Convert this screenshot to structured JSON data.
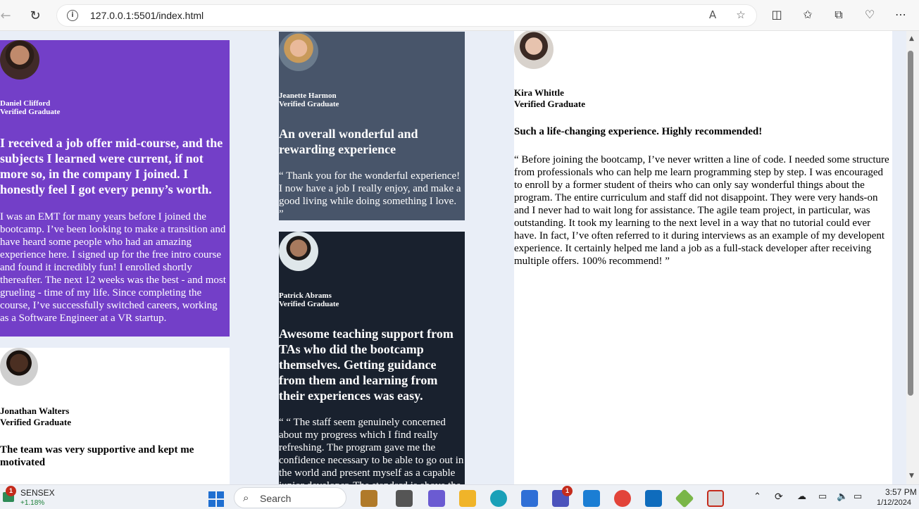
{
  "browser": {
    "url": "127.0.0.1:5501/index.html"
  },
  "testimonials": [
    {
      "name": "Daniel Clifford",
      "role": "Verified Graduate",
      "headline": "I received a job offer mid-course, and the subjects I learned were current, if not more so, in the company I joined. I honestly feel I got every penny’s worth.",
      "quote": "I was an EMT for many years before I joined the bootcamp. I’ve been looking to make a transition and have heard some people who had an amazing experience here. I signed up for the free intro course and found it incredibly fun! I enrolled shortly thereafter. The next 12 weeks was the best - and most grueling - time of my life. Since completing the course, I’ve successfully switched careers, working as a Software Engineer at a VR startup.",
      "bg": "#733fc8",
      "color": "#ffffff"
    },
    {
      "name": "Jonathan Walters",
      "role": "Verified Graduate",
      "headline": "The team was very supportive and kept me motivated",
      "bg": "#ffffff",
      "color": "#000000"
    },
    {
      "name": "Jeanette Harmon",
      "role": "Verified Graduate",
      "headline": "An overall wonderful and rewarding experience",
      "quote": "“ Thank you for the wonderful experience! I now have a job I really enjoy, and make a good living while doing something I love. ”",
      "bg": "#48556a",
      "color": "#ffffff"
    },
    {
      "name": "Patrick Abrams",
      "role": "Verified Graduate",
      "headline": "Awesome teaching support from TAs who did the bootcamp themselves. Getting guidance from them and learning from their experiences was easy.",
      "quote": "“ “ The staff seem genuinely concerned about my progress which I find really refreshing. The program gave me the confidence necessary to be able to go out in the world and present myself as a capable junior developer. The standard is above the rest. You will get the personal attention you need from an incredible community of smart and amazing people. ”",
      "bg": "#19212e",
      "color": "#ffffff"
    },
    {
      "name": "Kira Whittle",
      "role": "Verified Graduate",
      "headline": "Such a life-changing experience. Highly recommended!",
      "quote": "“ Before joining the bootcamp, I’ve never written a line of code. I needed some structure from professionals who can help me learn programming step by step. I was encouraged to enroll by a former student of theirs who can only say wonderful things about the program. The entire curriculum and staff did not disappoint. They were very hands-on and I never had to wait long for assistance. The agile team project, in particular, was outstanding. It took my learning to the next level in a way that no tutorial could ever have. In fact, I’ve often referred to it during interviews as an example of my developent experience. It certainly helped me land a job as a full-stack developer after receiving multiple offers. 100% recommend! ”",
      "bg": "#ffffff",
      "color": "#000000"
    }
  ],
  "taskbar": {
    "widget_title": "SENSEX",
    "widget_badge": "1",
    "widget_value": "+1.18%",
    "search_label": "Search",
    "teams_badge": "1",
    "time": "3:57 PM",
    "date": "1/12/2024"
  }
}
